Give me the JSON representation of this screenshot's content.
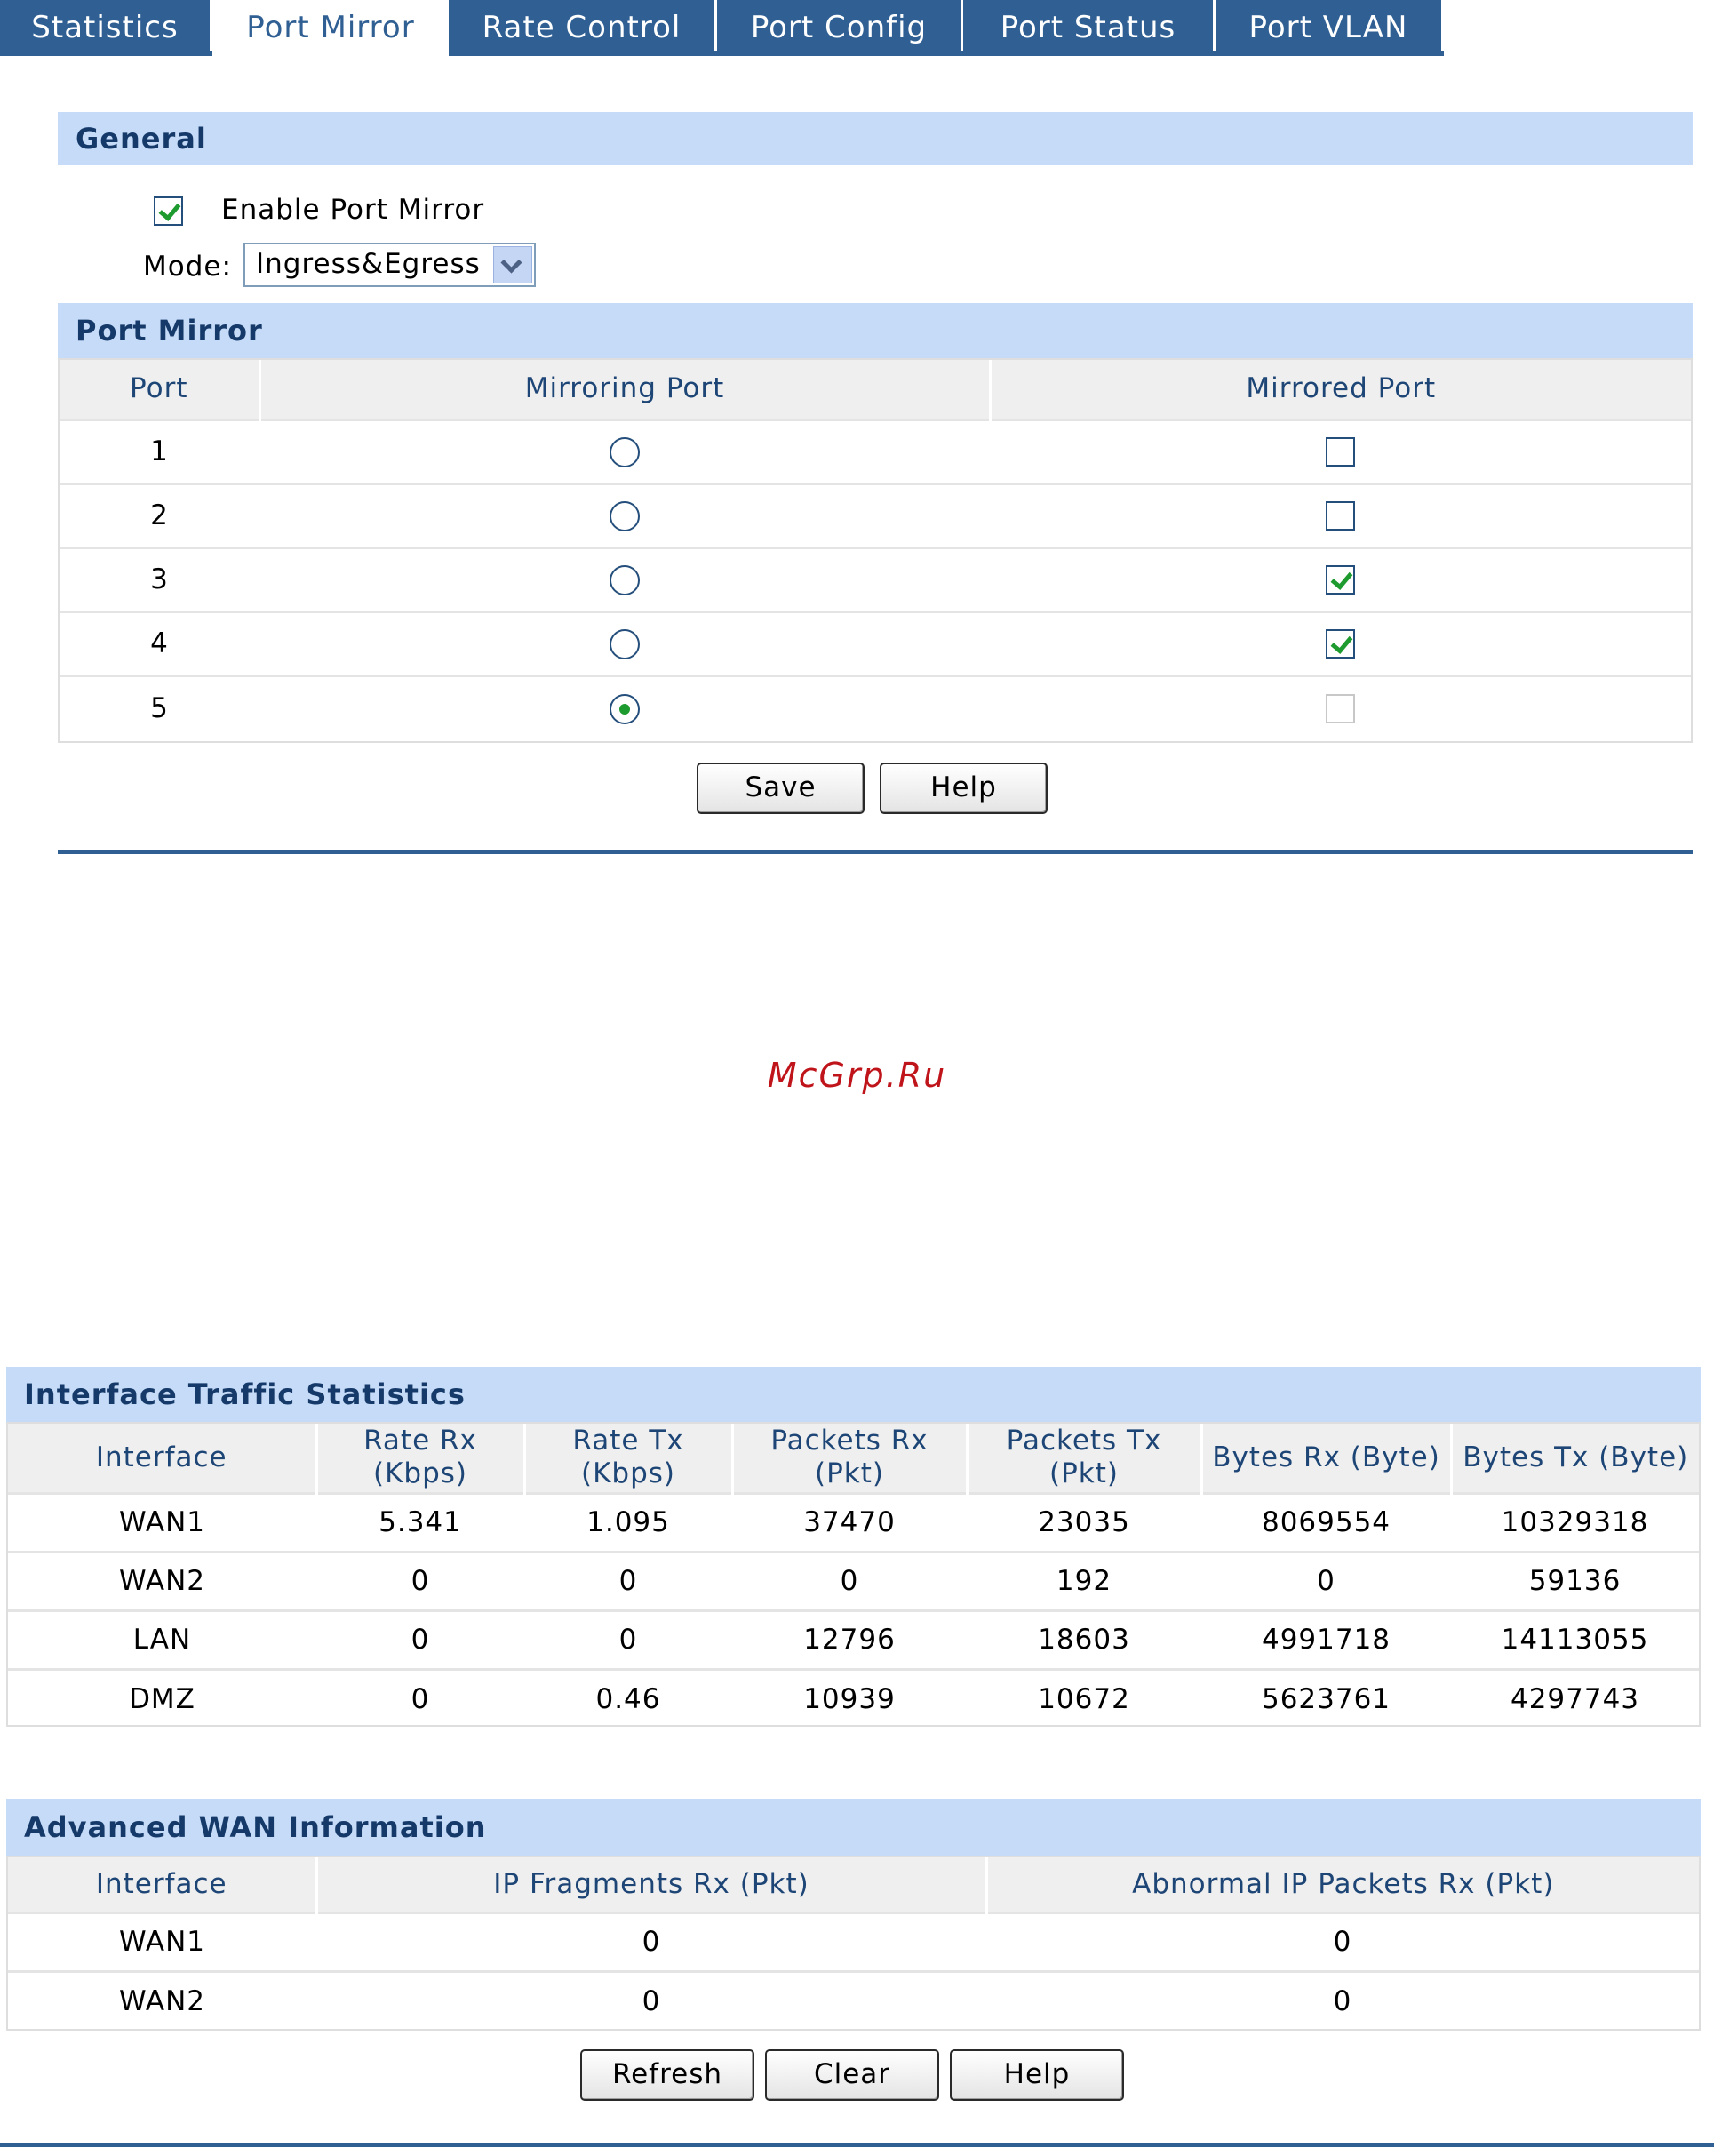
{
  "tabs": [
    {
      "label": "Statistics",
      "active": false
    },
    {
      "label": "Port Mirror",
      "active": true
    },
    {
      "label": "Rate Control",
      "active": false
    },
    {
      "label": "Port Config",
      "active": false
    },
    {
      "label": "Port Status",
      "active": false
    },
    {
      "label": "Port VLAN",
      "active": false
    }
  ],
  "general": {
    "title": "General",
    "enable_label": "Enable Port Mirror",
    "enable_checked": true,
    "mode_label": "Mode:",
    "mode_value": "Ingress&Egress"
  },
  "port_mirror": {
    "title": "Port Mirror",
    "headers": [
      "Port",
      "Mirroring Port",
      "Mirrored Port"
    ],
    "rows": [
      {
        "port": "1",
        "mirroring": false,
        "mirrored": false,
        "mirrored_disabled": false
      },
      {
        "port": "2",
        "mirroring": false,
        "mirrored": false,
        "mirrored_disabled": false
      },
      {
        "port": "3",
        "mirroring": false,
        "mirrored": true,
        "mirrored_disabled": false
      },
      {
        "port": "4",
        "mirroring": false,
        "mirrored": true,
        "mirrored_disabled": false
      },
      {
        "port": "5",
        "mirroring": true,
        "mirrored": false,
        "mirrored_disabled": true
      }
    ],
    "save_label": "Save",
    "help_label": "Help"
  },
  "watermark": "McGrp.Ru",
  "traffic": {
    "title": "Interface Traffic Statistics",
    "headers": [
      [
        "Interface"
      ],
      [
        "Rate Rx",
        "(Kbps)"
      ],
      [
        "Rate Tx",
        "(Kbps)"
      ],
      [
        "Packets Rx",
        "(Pkt)"
      ],
      [
        "Packets Tx",
        "(Pkt)"
      ],
      [
        "Bytes Rx (Byte)"
      ],
      [
        "Bytes Tx (Byte)"
      ]
    ],
    "rows": [
      [
        "WAN1",
        "5.341",
        "1.095",
        "37470",
        "23035",
        "8069554",
        "10329318"
      ],
      [
        "WAN2",
        "0",
        "0",
        "0",
        "192",
        "0",
        "59136"
      ],
      [
        "LAN",
        "0",
        "0",
        "12796",
        "18603",
        "4991718",
        "14113055"
      ],
      [
        "DMZ",
        "0",
        "0.46",
        "10939",
        "10672",
        "5623761",
        "4297743"
      ]
    ]
  },
  "advanced": {
    "title": "Advanced WAN Information",
    "headers": [
      "Interface",
      "IP Fragments Rx (Pkt)",
      "Abnormal IP Packets Rx (Pkt)"
    ],
    "rows": [
      [
        "WAN1",
        "0",
        "0"
      ],
      [
        "WAN2",
        "0",
        "0"
      ]
    ],
    "refresh_label": "Refresh",
    "clear_label": "Clear",
    "help_label": "Help"
  }
}
